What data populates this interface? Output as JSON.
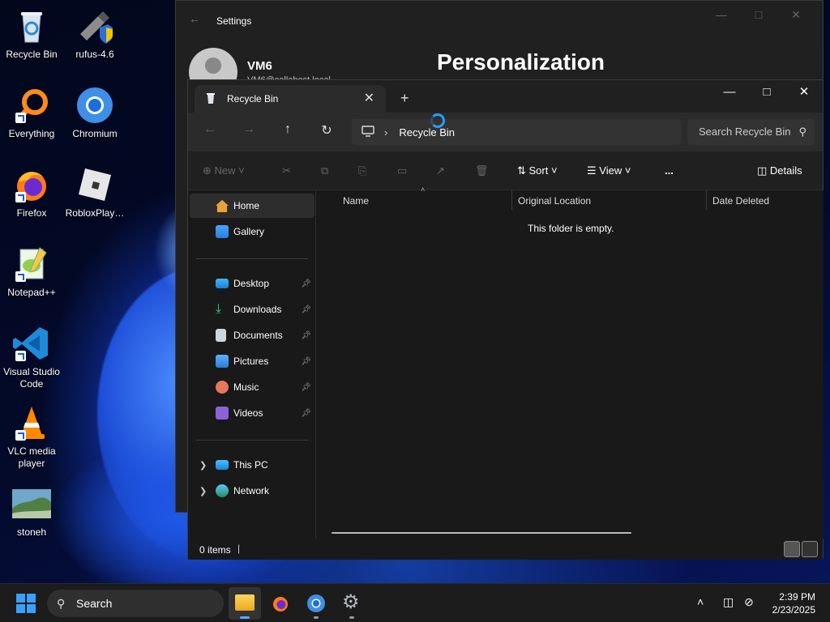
{
  "desktop": {
    "icons": [
      {
        "label": "Recycle Bin",
        "icon": "recycle-bin-icon"
      },
      {
        "label": "rufus-4.6",
        "icon": "rufus-icon"
      },
      {
        "label": "Everything",
        "icon": "everything-icon"
      },
      {
        "label": "Chromium",
        "icon": "chromium-icon"
      },
      {
        "label": "Firefox",
        "icon": "firefox-icon"
      },
      {
        "label": "RobloxPlay…",
        "icon": "roblox-icon"
      },
      {
        "label": "Notepad++",
        "icon": "notepadpp-icon"
      },
      {
        "label": "Visual Studio Code",
        "icon": "vscode-icon"
      },
      {
        "label": "VLC media player",
        "icon": "vlc-icon"
      },
      {
        "label": "stoneh",
        "icon": "image-file-icon"
      }
    ]
  },
  "settings": {
    "title": "Settings",
    "user_name": "VM6",
    "user_email": "VM6@callahost.local",
    "page_heading": "Personalization"
  },
  "explorer": {
    "tab_label": "Recycle Bin",
    "address_crumb": "Recycle Bin",
    "search_placeholder": "Search Recycle Bin",
    "commands": {
      "new": "New",
      "sort": "Sort",
      "view": "View",
      "more": "...",
      "details": "Details"
    },
    "nav": {
      "home": "Home",
      "gallery": "Gallery",
      "desktop": "Desktop",
      "downloads": "Downloads",
      "documents": "Documents",
      "pictures": "Pictures",
      "music": "Music",
      "videos": "Videos",
      "this_pc": "This PC",
      "network": "Network"
    },
    "columns": {
      "name": "Name",
      "original_location": "Original Location",
      "date_deleted": "Date Deleted"
    },
    "empty_message": "This folder is empty.",
    "status_count": "0 items"
  },
  "taskbar": {
    "search_label": "Search",
    "time": "2:39 PM",
    "date": "2/23/2025"
  },
  "colors": {
    "accent": "#2d9cff",
    "window_bg": "#191919"
  }
}
